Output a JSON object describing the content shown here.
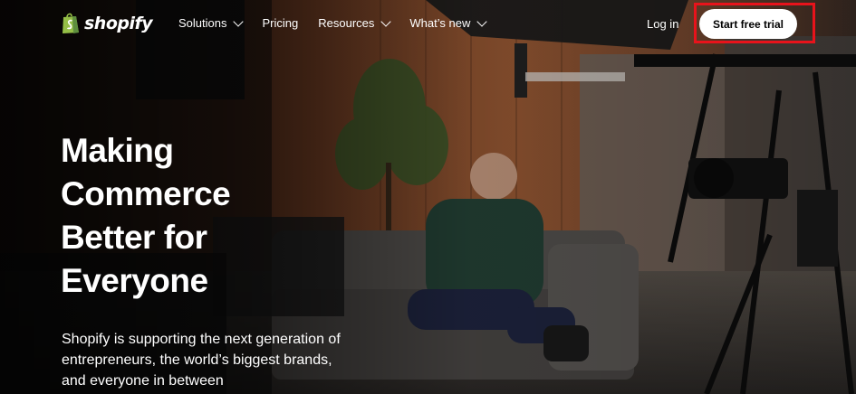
{
  "brand": {
    "name": "shopify",
    "logo_icon": "shopping-bag-icon",
    "logo_color": "#95bf47"
  },
  "nav": {
    "items": [
      {
        "label": "Solutions",
        "has_dropdown": true
      },
      {
        "label": "Pricing",
        "has_dropdown": false
      },
      {
        "label": "Resources",
        "has_dropdown": true
      },
      {
        "label": "What’s new",
        "has_dropdown": true
      }
    ],
    "login_label": "Log in",
    "cta_label": "Start free trial"
  },
  "hero": {
    "headline_lines": [
      "Making",
      "Commerce",
      "Better for",
      "Everyone"
    ],
    "subtext_lines": [
      "Shopify is supporting the next generation of",
      "entrepreneurs, the world’s biggest brands,",
      "and everyone in between"
    ],
    "background": "video-still-studio-interview"
  },
  "colors": {
    "text": "#ffffff",
    "cta_background": "#ffffff",
    "cta_text": "#000000",
    "highlight_outline": "#e8131b"
  }
}
